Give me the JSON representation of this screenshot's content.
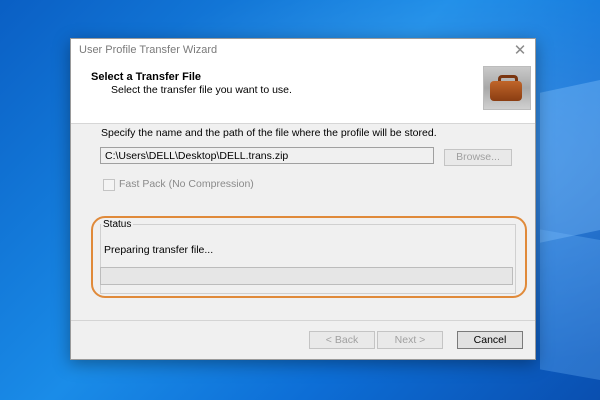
{
  "window": {
    "title": "User Profile Transfer Wizard",
    "close_glyph": "✕"
  },
  "header": {
    "title": "Select a Transfer File",
    "subtitle": "Select the transfer file you want to use.",
    "image_icon": "briefcase-icon"
  },
  "main": {
    "instruction": "Specify the name and the path of the file where the profile will be stored.",
    "path_value": "C:\\Users\\DELL\\Desktop\\DELL.trans.zip",
    "browse_label": "Browse...",
    "fastpack_label": "Fast Pack (No Compression)",
    "fastpack_checked": false
  },
  "status": {
    "legend": "Status",
    "message": "Preparing transfer file...",
    "progress_fraction": 0
  },
  "footer": {
    "back_label": "< Back",
    "next_label": "Next >",
    "cancel_label": "Cancel"
  },
  "colors": {
    "highlight": "#e08a3a",
    "progress": "#06b025"
  }
}
